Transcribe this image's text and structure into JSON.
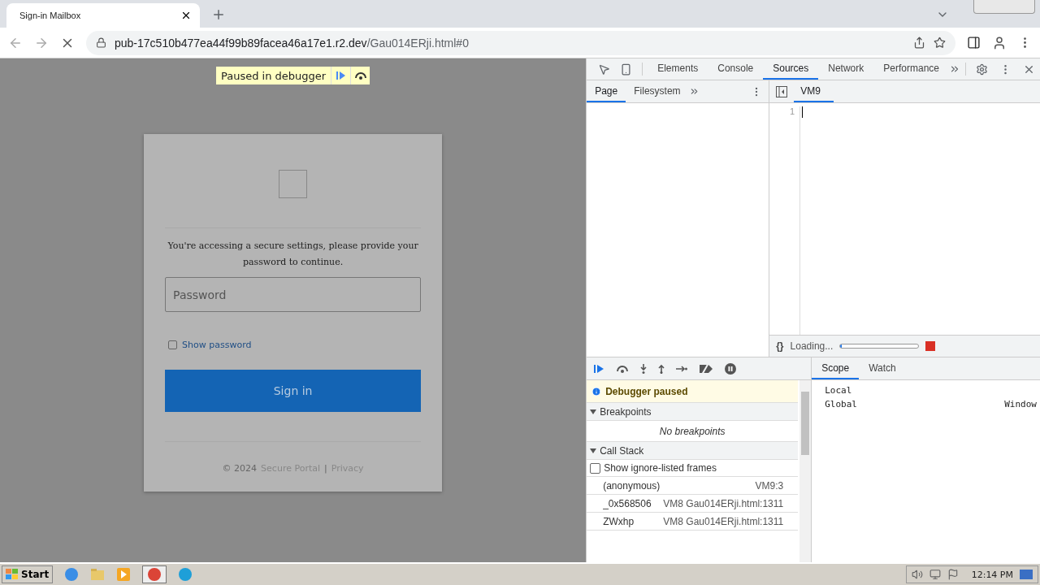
{
  "browser": {
    "tab_title": "Sign-in Mailbox",
    "url_host": "pub-17c510b477ea44f99b89facea46a17e1.r2.dev",
    "url_path": "/Gau014ERji.html#0"
  },
  "page": {
    "paused_banner": "Paused in debugger",
    "message": "You're accessing a secure settings, please provide your password to continue.",
    "password_placeholder": "Password",
    "show_password": {
      "label": "Show password",
      "checked": false
    },
    "sign_in": "Sign in",
    "footer": {
      "copyright": "© 2024",
      "brand": "Secure Portal",
      "separator": "|",
      "privacy": "Privacy"
    }
  },
  "devtools": {
    "tabs": [
      {
        "label": "Elements",
        "selected": false
      },
      {
        "label": "Console",
        "selected": false
      },
      {
        "label": "Sources",
        "selected": true
      },
      {
        "label": "Network",
        "selected": false
      },
      {
        "label": "Performance",
        "selected": false
      }
    ],
    "navigator_tabs": [
      {
        "label": "Page",
        "selected": true
      },
      {
        "label": "Filesystem",
        "selected": false
      }
    ],
    "editor_tab": "VM9",
    "line_numbers": [
      "1"
    ],
    "status": {
      "braces": "{}",
      "text": "Loading...",
      "level": 0.02
    },
    "paused_message": "Debugger paused",
    "breakpoints": {
      "title": "Breakpoints",
      "expanded": true,
      "empty": "No breakpoints"
    },
    "call_stack": {
      "title": "Call Stack",
      "expanded": true,
      "show_ignored": {
        "label": "Show ignore-listed frames",
        "checked": false
      },
      "frames": [
        {
          "name": "(anonymous)",
          "location": "VM9:3"
        },
        {
          "name": "_0x568506",
          "location": "VM8 Gau014ERji.html:1311"
        },
        {
          "name": "ZWxhp",
          "location": "VM8 Gau014ERji.html:1311"
        }
      ]
    },
    "side_tabs": [
      {
        "label": "Scope",
        "selected": true
      },
      {
        "label": "Watch",
        "selected": false
      }
    ],
    "scope": [
      {
        "name": "Local"
      },
      {
        "name": "Global",
        "value": "Window"
      }
    ]
  },
  "taskbar": {
    "start": "Start",
    "clock": "12:14 PM"
  }
}
